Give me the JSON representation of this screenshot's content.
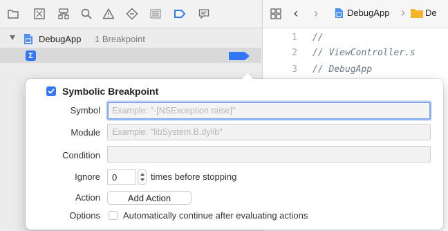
{
  "navigator": {
    "toolbar_icons": [
      "folder-icon",
      "source-control-icon",
      "hierarchy-icon",
      "find-icon",
      "issue-warning-icon",
      "test-diamond-icon",
      "debug-list-icon",
      "breakpoint-icon",
      "report-icon"
    ],
    "project_name": "DebugApp",
    "breakpoint_count": "1 Breakpoint",
    "breakpoint_row_icon": "Σ",
    "accent": "#3278f6"
  },
  "editor": {
    "jump_bar": {
      "project": "DebugApp",
      "folder": "De"
    },
    "lines": [
      {
        "num": "1",
        "text": "//"
      },
      {
        "num": "2",
        "text": "//  ViewController.s"
      },
      {
        "num": "3",
        "text": "//  DebugApp"
      }
    ]
  },
  "popover": {
    "title": "Symbolic Breakpoint",
    "enabled": true,
    "symbol": {
      "label": "Symbol",
      "placeholder": "Example: \"-[NSException raise]\"",
      "value": ""
    },
    "module": {
      "label": "Module",
      "placeholder": "Example: \"libSystem.B.dylib\"",
      "value": ""
    },
    "condition": {
      "label": "Condition",
      "value": ""
    },
    "ignore": {
      "label": "Ignore",
      "value": "0",
      "suffix": "times before stopping"
    },
    "action": {
      "label": "Action",
      "button": "Add Action"
    },
    "options": {
      "label": "Options",
      "checkbox_label": "Automatically continue after evaluating actions",
      "checked": false
    }
  }
}
